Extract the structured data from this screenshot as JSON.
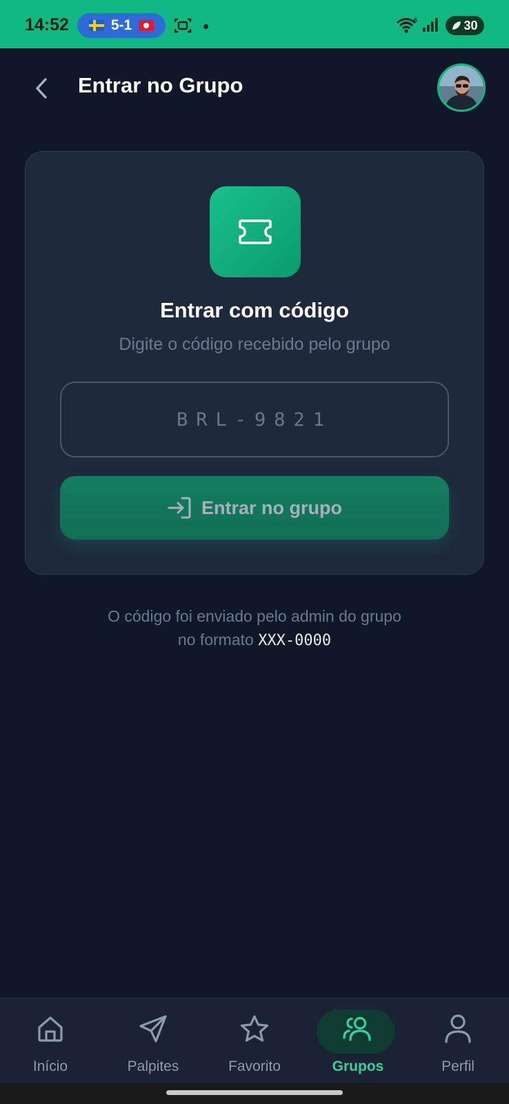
{
  "status_bar": {
    "time": "14:52",
    "score": "5-1",
    "battery": "30",
    "wifi_badge": "6",
    "color": "#10b981"
  },
  "header": {
    "title": "Entrar no Grupo",
    "back_icon": "chevron-left-icon",
    "avatar_icon": "avatar"
  },
  "card": {
    "icon": "ticket-icon",
    "title": "Entrar com código",
    "subtitle": "Digite o código recebido pelo grupo",
    "input_placeholder": "BRL-9821",
    "input_value": "",
    "button_label": "Entrar no grupo",
    "button_icon": "login-icon",
    "accent_color": "#10b981"
  },
  "hint": {
    "line1": "O código foi enviado pelo admin do grupo",
    "line2_prefix": "no formato ",
    "line2_code": "XXX-0000"
  },
  "bottom_nav": {
    "items": [
      {
        "label": "Início",
        "icon": "home-icon",
        "active": false
      },
      {
        "label": "Palpites",
        "icon": "send-icon",
        "active": false
      },
      {
        "label": "Favorito",
        "icon": "star-icon",
        "active": false
      },
      {
        "label": "Grupos",
        "icon": "users-icon",
        "active": true
      },
      {
        "label": "Perfil",
        "icon": "user-icon",
        "active": false
      }
    ],
    "active_color": "#34d399"
  }
}
